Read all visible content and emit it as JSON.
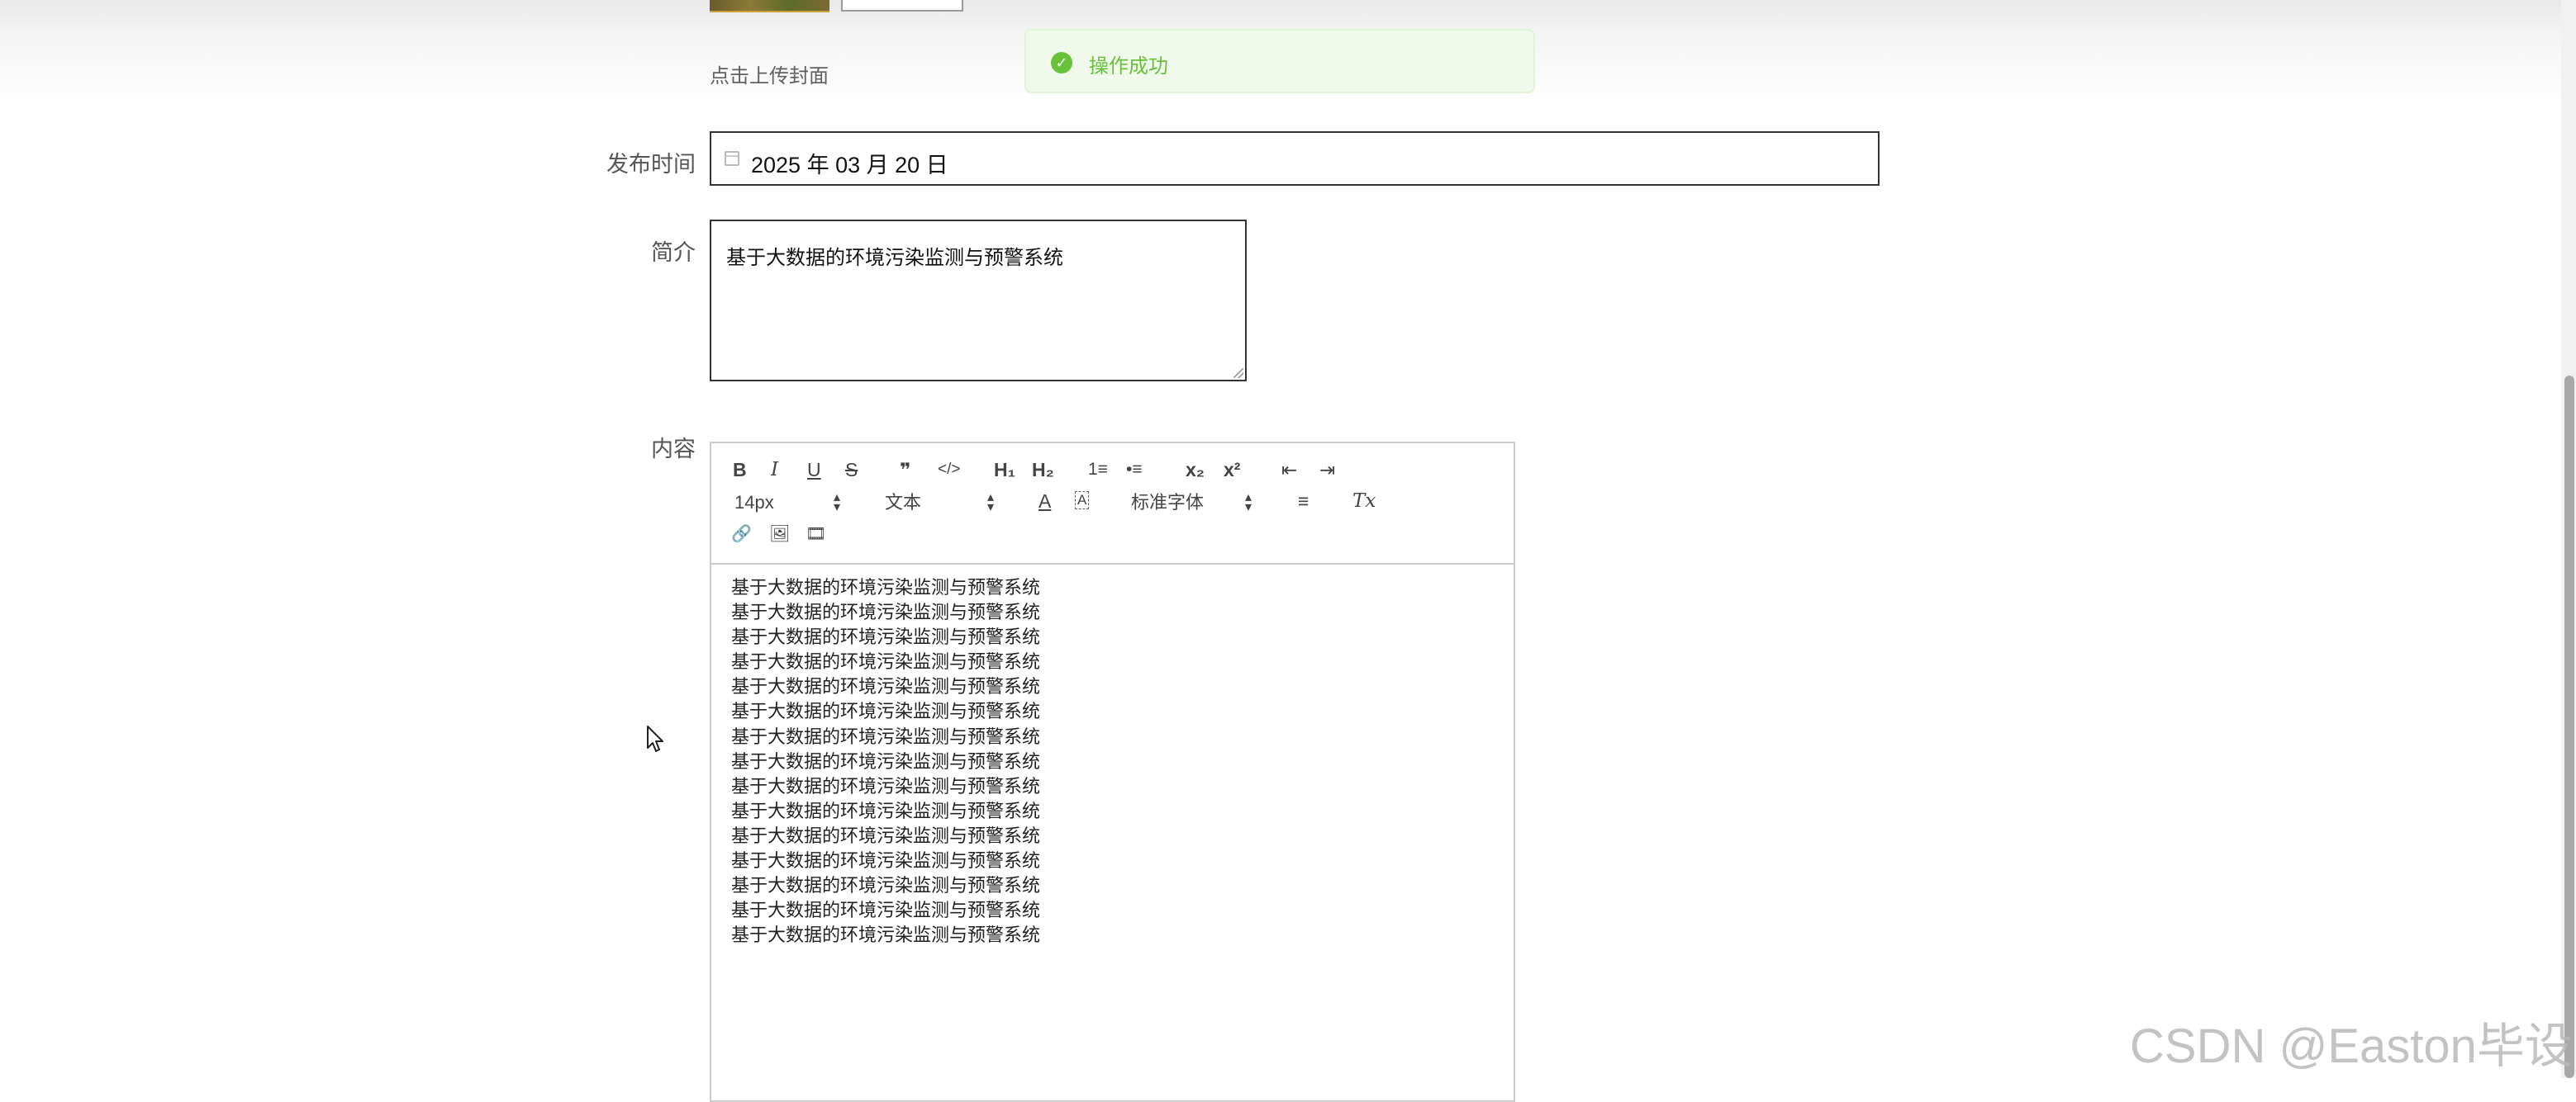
{
  "cover": {
    "upload_hint": "点击上传封面"
  },
  "toast": {
    "message": "操作成功",
    "icon": "check-circle-icon",
    "color": "#67c23a"
  },
  "form": {
    "publish_time": {
      "label": "发布时间",
      "value": "2025 年 03 月 20 日"
    },
    "summary": {
      "label": "简介",
      "value": "基于大数据的环境污染监测与预警系统"
    },
    "content": {
      "label": "内容"
    }
  },
  "editor": {
    "toolbar": {
      "bold": "B",
      "italic": "I",
      "underline": "U",
      "strike": "S",
      "blockquote": "❞",
      "code": "</>",
      "h1": "H₁",
      "h2": "H₂",
      "ordered_list": "1≡",
      "bullet_list": "•≡",
      "subscript": "x₂",
      "superscript": "x²",
      "outdent": "⇤",
      "indent": "⇥",
      "size_select": "14px",
      "header_select": "文本",
      "font_color": "A",
      "background_color": "A",
      "font_select": "标准字体",
      "align": "≡",
      "clean": "Tx",
      "link": "🔗",
      "image": "🖼",
      "video": "🎞"
    },
    "lines": [
      "基于大数据的环境污染监测与预警系统",
      "基于大数据的环境污染监测与预警系统",
      "基于大数据的环境污染监测与预警系统",
      "基于大数据的环境污染监测与预警系统",
      "基于大数据的环境污染监测与预警系统",
      "基于大数据的环境污染监测与预警系统",
      "基于大数据的环境污染监测与预警系统",
      "基于大数据的环境污染监测与预警系统",
      "基于大数据的环境污染监测与预警系统",
      "基于大数据的环境污染监测与预警系统",
      "基于大数据的环境污染监测与预警系统",
      "基于大数据的环境污染监测与预警系统",
      "基于大数据的环境污染监测与预警系统",
      "基于大数据的环境污染监测与预警系统",
      "基于大数据的环境污染监测与预警系统"
    ]
  },
  "watermark": "CSDN @Easton毕设"
}
